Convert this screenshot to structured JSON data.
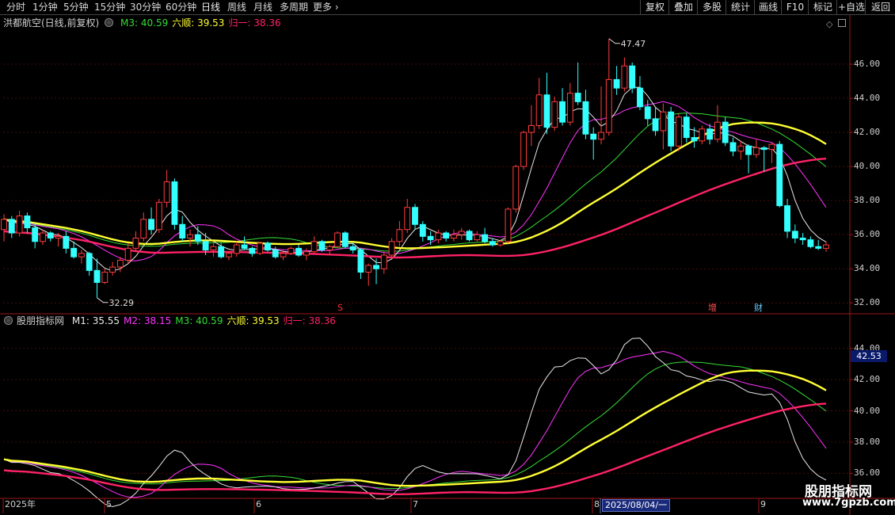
{
  "toolbar": {
    "periods": [
      "分时",
      "1分钟",
      "5分钟",
      "15分钟",
      "30分钟",
      "60分钟",
      "日线",
      "周线",
      "月线",
      "多周期",
      "更多"
    ],
    "buttons": [
      "复权",
      "叠加",
      "多股",
      "统计",
      "画线",
      "F10",
      "标记",
      "+自选",
      "返回"
    ]
  },
  "main_legend": {
    "title": "洪都航空(日线,前复权)",
    "items": [
      {
        "label": "M3: 40.59",
        "color": "#33dd33"
      },
      {
        "label": "六顺: 39.53",
        "color": "#ffff33"
      },
      {
        "label": "归一: 38.36",
        "color": "#ff2266"
      }
    ]
  },
  "sub_legend": {
    "title": "股朋指标网",
    "items": [
      {
        "label": "M1: 35.55",
        "color": "#e8e8e8"
      },
      {
        "label": "M2: 38.15",
        "color": "#ff33ff"
      },
      {
        "label": "M3: 40.59",
        "color": "#33dd33"
      },
      {
        "label": "六顺: 39.53",
        "color": "#ffff33"
      },
      {
        "label": "归一: 38.36",
        "color": "#ff2266"
      }
    ]
  },
  "annotations": {
    "high_marker": "47.47",
    "low_marker": "32.29",
    "event_s": "S",
    "event_zeng": "增",
    "event_cai": "财",
    "current_price": "42.53",
    "date_badge": "2025/08/04/一"
  },
  "watermark": {
    "line1": "股朋指标网",
    "line2": "www.7gpzb.com"
  },
  "chart_data": [
    {
      "type": "candlestick",
      "title": "洪都航空(日线,前复权)",
      "ylim": [
        31.5,
        48
      ],
      "y_ticks": [
        "46.00",
        "44.00",
        "42.00",
        "40.00",
        "38.00",
        "36.00",
        "34.00",
        "32.00"
      ],
      "x_labels": [
        "2025年",
        "5",
        "6",
        "7",
        "8",
        "9"
      ],
      "candles": [
        [
          36.3,
          37.2,
          35.6,
          36.9
        ],
        [
          36.9,
          37.1,
          35.8,
          36.1
        ],
        [
          36.1,
          37.4,
          35.9,
          37.1
        ],
        [
          37.1,
          37.3,
          36.1,
          36.4
        ],
        [
          36.4,
          36.7,
          35.2,
          35.6
        ],
        [
          35.6,
          36.3,
          35.4,
          36.1
        ],
        [
          36.1,
          36.2,
          35.6,
          35.8
        ],
        [
          35.8,
          36.1,
          35.3,
          35.9
        ],
        [
          35.9,
          36.2,
          34.9,
          35.2
        ],
        [
          35.2,
          35.6,
          34.6,
          34.7
        ],
        [
          34.7,
          35.1,
          34.3,
          34.9
        ],
        [
          34.9,
          35.0,
          33.6,
          33.9
        ],
        [
          33.9,
          34.6,
          32.3,
          33.2
        ],
        [
          33.2,
          34.0,
          33.1,
          33.8
        ],
        [
          33.8,
          34.4,
          33.6,
          34.1
        ],
        [
          34.1,
          34.7,
          33.8,
          34.5
        ],
        [
          34.5,
          35.5,
          34.3,
          35.2
        ],
        [
          35.2,
          36.2,
          35.0,
          35.8
        ],
        [
          35.8,
          37.3,
          35.6,
          36.9
        ],
        [
          36.9,
          37.6,
          36.0,
          36.3
        ],
        [
          36.3,
          38.1,
          36.1,
          37.9
        ],
        [
          37.9,
          39.8,
          37.6,
          39.1
        ],
        [
          39.1,
          39.3,
          36.3,
          36.6
        ],
        [
          36.6,
          37.1,
          35.6,
          35.8
        ],
        [
          35.8,
          36.3,
          35.3,
          36.0
        ],
        [
          36.0,
          36.5,
          35.4,
          35.6
        ],
        [
          35.6,
          36.1,
          34.8,
          35.1
        ],
        [
          35.1,
          35.6,
          34.7,
          35.3
        ],
        [
          35.3,
          35.5,
          34.6,
          34.7
        ],
        [
          34.7,
          35.0,
          34.5,
          34.9
        ],
        [
          34.9,
          35.6,
          34.7,
          35.4
        ],
        [
          35.4,
          35.9,
          35.1,
          35.2
        ],
        [
          35.2,
          35.3,
          34.7,
          34.9
        ],
        [
          34.9,
          35.6,
          34.8,
          35.5
        ],
        [
          35.5,
          35.6,
          35.0,
          35.1
        ],
        [
          35.1,
          35.3,
          34.6,
          34.7
        ],
        [
          34.7,
          35.1,
          34.5,
          34.9
        ],
        [
          34.9,
          35.3,
          34.8,
          35.2
        ],
        [
          35.2,
          35.4,
          34.7,
          34.8
        ],
        [
          34.8,
          35.2,
          34.5,
          35.0
        ],
        [
          35.0,
          35.9,
          34.9,
          35.6
        ],
        [
          35.6,
          35.7,
          35.0,
          35.1
        ],
        [
          35.1,
          35.4,
          34.8,
          35.3
        ],
        [
          35.3,
          36.2,
          35.2,
          36.1
        ],
        [
          36.1,
          36.2,
          35.2,
          35.3
        ],
        [
          35.3,
          35.5,
          34.9,
          35.1
        ],
        [
          35.1,
          35.2,
          33.4,
          33.8
        ],
        [
          33.8,
          34.3,
          33.0,
          34.2
        ],
        [
          34.2,
          34.6,
          33.1,
          34.0
        ],
        [
          34.0,
          35.0,
          33.7,
          34.8
        ],
        [
          34.8,
          35.8,
          34.6,
          35.6
        ],
        [
          35.6,
          36.8,
          35.3,
          36.3
        ],
        [
          36.3,
          38.1,
          36.1,
          37.6
        ],
        [
          37.6,
          37.8,
          36.3,
          36.6
        ],
        [
          36.6,
          36.8,
          35.6,
          35.9
        ],
        [
          35.9,
          36.2,
          35.4,
          35.7
        ],
        [
          35.7,
          36.3,
          35.5,
          36.1
        ],
        [
          36.1,
          36.2,
          35.6,
          35.8
        ],
        [
          35.8,
          36.3,
          35.6,
          36.0
        ],
        [
          36.0,
          36.4,
          35.7,
          36.2
        ],
        [
          36.2,
          36.3,
          35.6,
          35.7
        ],
        [
          35.7,
          36.2,
          35.6,
          36.0
        ],
        [
          36.0,
          36.4,
          35.5,
          35.6
        ],
        [
          35.6,
          35.8,
          35.3,
          35.4
        ],
        [
          35.4,
          35.7,
          35.3,
          35.6
        ],
        [
          35.6,
          37.6,
          35.5,
          37.5
        ],
        [
          37.5,
          40.1,
          37.3,
          40.0
        ],
        [
          40.0,
          42.1,
          39.8,
          42.0
        ],
        [
          42.0,
          43.6,
          41.2,
          42.4
        ],
        [
          42.4,
          45.2,
          42.2,
          44.2
        ],
        [
          44.2,
          45.5,
          41.9,
          42.3
        ],
        [
          42.3,
          44.1,
          42.1,
          43.8
        ],
        [
          43.8,
          44.6,
          42.4,
          42.6
        ],
        [
          42.6,
          44.9,
          42.4,
          44.3
        ],
        [
          44.3,
          46.1,
          43.6,
          43.8
        ],
        [
          43.8,
          44.5,
          41.6,
          41.9
        ],
        [
          41.9,
          42.3,
          40.4,
          41.6
        ],
        [
          41.6,
          44.7,
          41.3,
          42.0
        ],
        [
          42.0,
          47.5,
          41.8,
          45.1
        ],
        [
          45.1,
          45.9,
          44.2,
          44.6
        ],
        [
          44.6,
          46.4,
          44.4,
          45.9
        ],
        [
          45.9,
          46.1,
          44.3,
          44.6
        ],
        [
          44.6,
          45.3,
          43.3,
          43.5
        ],
        [
          43.5,
          43.9,
          42.4,
          42.8
        ],
        [
          42.8,
          43.5,
          41.8,
          42.1
        ],
        [
          42.1,
          43.7,
          41.0,
          43.2
        ],
        [
          43.2,
          43.5,
          40.9,
          41.2
        ],
        [
          41.2,
          43.1,
          40.9,
          42.9
        ],
        [
          42.9,
          43.1,
          41.4,
          41.7
        ],
        [
          41.7,
          42.3,
          41.1,
          41.5
        ],
        [
          41.5,
          42.4,
          41.3,
          42.2
        ],
        [
          42.2,
          42.5,
          41.3,
          41.6
        ],
        [
          41.6,
          43.6,
          41.4,
          42.6
        ],
        [
          42.6,
          42.9,
          41.2,
          41.4
        ],
        [
          41.4,
          41.7,
          40.6,
          40.9
        ],
        [
          40.9,
          41.5,
          40.4,
          41.2
        ],
        [
          41.2,
          41.3,
          39.6,
          40.7
        ],
        [
          40.7,
          41.6,
          40.5,
          41.1
        ],
        [
          41.1,
          41.2,
          39.7,
          41.0
        ],
        [
          41.0,
          41.4,
          40.2,
          41.3
        ],
        [
          41.3,
          41.5,
          37.6,
          37.7
        ],
        [
          37.7,
          38.1,
          35.8,
          36.2
        ],
        [
          36.2,
          36.6,
          35.5,
          35.8
        ],
        [
          35.8,
          36.1,
          35.4,
          35.7
        ],
        [
          35.7,
          35.9,
          35.2,
          35.3
        ],
        [
          35.3,
          35.7,
          35.1,
          35.2
        ],
        [
          35.2,
          35.6,
          35.0,
          35.4
        ]
      ]
    },
    {
      "type": "line",
      "title": "股朋指标网",
      "ylim": [
        34.5,
        45.3
      ],
      "y_ticks": [
        "44.00",
        "42.00",
        "40.00",
        "38.00",
        "36.00"
      ]
    }
  ]
}
